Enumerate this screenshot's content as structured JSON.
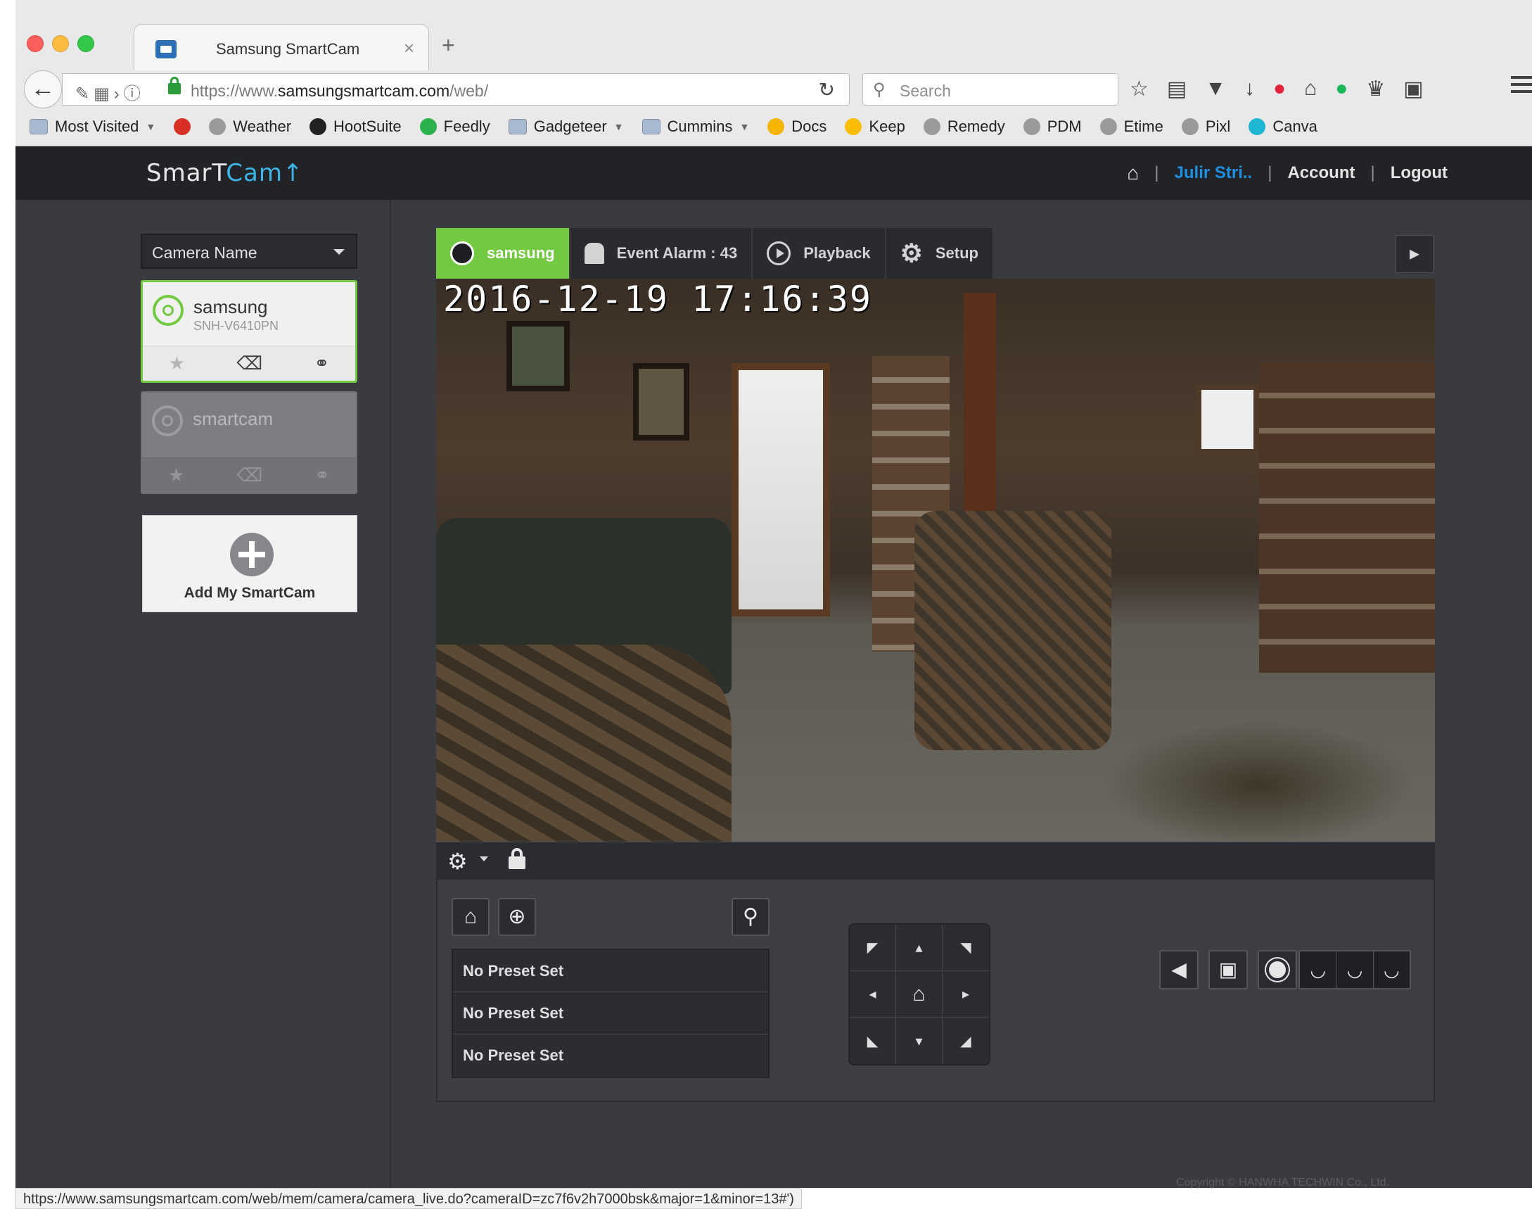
{
  "browser": {
    "tab_title": "Samsung SmartCam",
    "url_prefix": "https://www.",
    "url_domain": "samsungsmartcam.com",
    "url_path": "/web/",
    "search_placeholder": "Search",
    "status_url": "https://www.samsungsmartcam.com/web/mem/camera/camera_live.do?cameraID=zc7f6v2h7000bsk&major=1&minor=13#')",
    "bookmarks": [
      {
        "label": "Most Visited",
        "icon": "folder-icon",
        "dropdown": true
      },
      {
        "label": "",
        "icon": "gmail-icon"
      },
      {
        "label": "Weather",
        "icon": "globe-icon"
      },
      {
        "label": "HootSuite",
        "icon": "owl-icon"
      },
      {
        "label": "Feedly",
        "icon": "feedly-icon"
      },
      {
        "label": "Gadgeteer",
        "icon": "folder-icon",
        "dropdown": true
      },
      {
        "label": "Cummins",
        "icon": "folder-icon",
        "dropdown": true
      },
      {
        "label": "Docs",
        "icon": "drive-icon"
      },
      {
        "label": "Keep",
        "icon": "keep-icon"
      },
      {
        "label": "Remedy",
        "icon": "globe-icon"
      },
      {
        "label": "PDM",
        "icon": "globe-icon"
      },
      {
        "label": "Etime",
        "icon": "globe-icon"
      },
      {
        "label": "Pixl",
        "icon": "globe-icon"
      },
      {
        "label": "Canva",
        "icon": "canva-icon"
      }
    ]
  },
  "header": {
    "logo_part1": "SmarT",
    "logo_part2": "Cam",
    "user": "Julir Stri..",
    "account": "Account",
    "logout": "Logout"
  },
  "sidebar": {
    "select_label": "Camera Name",
    "cameras": [
      {
        "name": "samsung",
        "model": "SNH-V6410PN",
        "active": true
      },
      {
        "name": "smartcam",
        "model": "",
        "active": false
      }
    ],
    "add_label": "Add My SmartCam"
  },
  "tabs": {
    "camera": "samsung",
    "event": "Event Alarm : 43",
    "playback": "Playback",
    "setup": "Setup"
  },
  "video": {
    "timestamp": "2016-12-19  17:16:39"
  },
  "presets": [
    "No Preset Set",
    "No Preset Set",
    "No Preset Set"
  ],
  "footer": {
    "copyright": "Copyright © HANWHA TECHWIN Co., Ltd."
  },
  "colors": {
    "accent_green": "#74c943",
    "header_bg": "#222327",
    "body_bg": "#3a3b41",
    "user_link": "#1f8fe0"
  }
}
